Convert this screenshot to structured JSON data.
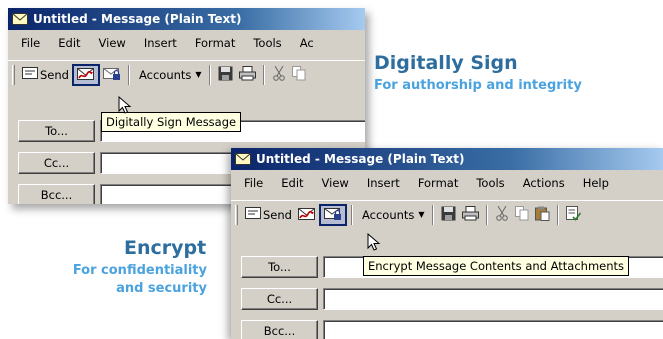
{
  "window_top": {
    "title": "Untitled - Message (Plain Text)",
    "menu": [
      "File",
      "Edit",
      "View",
      "Insert",
      "Format",
      "Tools",
      "Ac"
    ],
    "toolbar": {
      "send_label": "Send",
      "accounts_label": "Accounts"
    },
    "tooltip": "Digitally Sign Message",
    "fields": {
      "to_label": "To...",
      "cc_label": "Cc...",
      "bcc_label": "Bcc..."
    }
  },
  "window_bottom": {
    "title": "Untitled - Message (Plain Text)",
    "menu": [
      "File",
      "Edit",
      "View",
      "Insert",
      "Format",
      "Tools",
      "Actions",
      "Help"
    ],
    "toolbar": {
      "send_label": "Send",
      "accounts_label": "Accounts"
    },
    "tooltip": "Encrypt Message Contents and Attachments",
    "fields": {
      "to_label": "To...",
      "cc_label": "Cc...",
      "bcc_label": "Bcc..."
    }
  },
  "callouts": {
    "sign": {
      "title": "Digitally Sign",
      "subtitle": "For authorship and integrity"
    },
    "encrypt": {
      "title": "Encrypt",
      "subtitle_line1": "For confidentiality",
      "subtitle_line2": "and security"
    }
  },
  "icons": [
    "envelope-icon",
    "send-icon",
    "sign-icon",
    "encrypt-icon",
    "save-icon",
    "print-icon",
    "cut-icon",
    "copy-icon",
    "paste-icon",
    "cursor-icon"
  ],
  "colors": {
    "title_dark": "#0a246a",
    "title_light": "#a6caf0",
    "callout_title": "#2e6e9e",
    "callout_sub": "#4aa3df",
    "tooltip_bg": "#ffffe1",
    "chrome": "#d4d0c8"
  }
}
